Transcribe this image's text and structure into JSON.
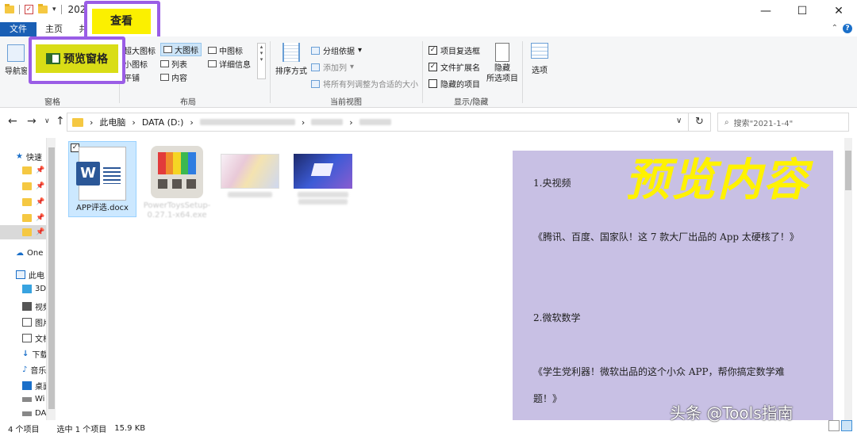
{
  "title_bar": {
    "title": "202",
    "window_buttons": [
      "—",
      "☐",
      "✕"
    ]
  },
  "tabs": {
    "file": "文件",
    "home": "主页",
    "share": "共",
    "view": "查看"
  },
  "ribbon": {
    "nav_pane": "导航窗格",
    "preview_pane": "预览窗格",
    "pane_group": "窗格",
    "layout": {
      "xl_icons": "超大图标",
      "large_icons": "大图标",
      "medium_icons": "中图标",
      "small_icons": "小图标",
      "list": "列表",
      "details": "详细信息",
      "tiles": "平铺",
      "content": "内容"
    },
    "layout_group": "布局",
    "sort_by": "排序方式",
    "group_by": "分组依据",
    "add_column": "添加列",
    "fit_columns": "将所有列调整为合适的大小",
    "current_view_group": "当前视图",
    "item_checkboxes": "项目复选框",
    "file_extensions": "文件扩展名",
    "hidden_items": "隐藏的项目",
    "hide_selected": "隐藏",
    "hide_selected_2": "所选项目",
    "show_hide_group": "显示/隐藏",
    "options": "选项"
  },
  "address": {
    "crumbs": [
      "此电脑",
      "DATA (D:)"
    ],
    "search_placeholder": "搜索\"2021-1-4\""
  },
  "sidebar": {
    "quick_access": "快速",
    "onedrive": "One",
    "this_pc": "此电",
    "items": [
      "3D",
      "视频",
      "图片",
      "文档",
      "下载",
      "音乐",
      "桌面",
      "Wi",
      "DA"
    ]
  },
  "files": [
    {
      "name": "APP评选.docx",
      "selected": true
    },
    {
      "name": "PowerToysSetup-0.27.1-x64.exe",
      "selected": false
    },
    {
      "name": "",
      "selected": false
    },
    {
      "name": "",
      "selected": false
    }
  ],
  "preview": {
    "overlay_title": "预览内容",
    "lines": [
      "1.央视频",
      "《腾讯、百度、国家队！这 7 款大厂出品的 App 太硬核了！》",
      "2.微软数学",
      "《学生党利器！微软出品的这个小众 APP，帮你搞定数学难",
      "题！》"
    ]
  },
  "status": {
    "count": "4 个项目",
    "selection": "选中 1 个项目",
    "size": "15.9 KB"
  },
  "watermark": "头条 @Tools指南",
  "colors": {
    "highlight_border": "#9a5de6",
    "highlight_fill": "#fbf000",
    "preview_bg": "#c8c0e4",
    "accent": "#1a5fb4"
  }
}
